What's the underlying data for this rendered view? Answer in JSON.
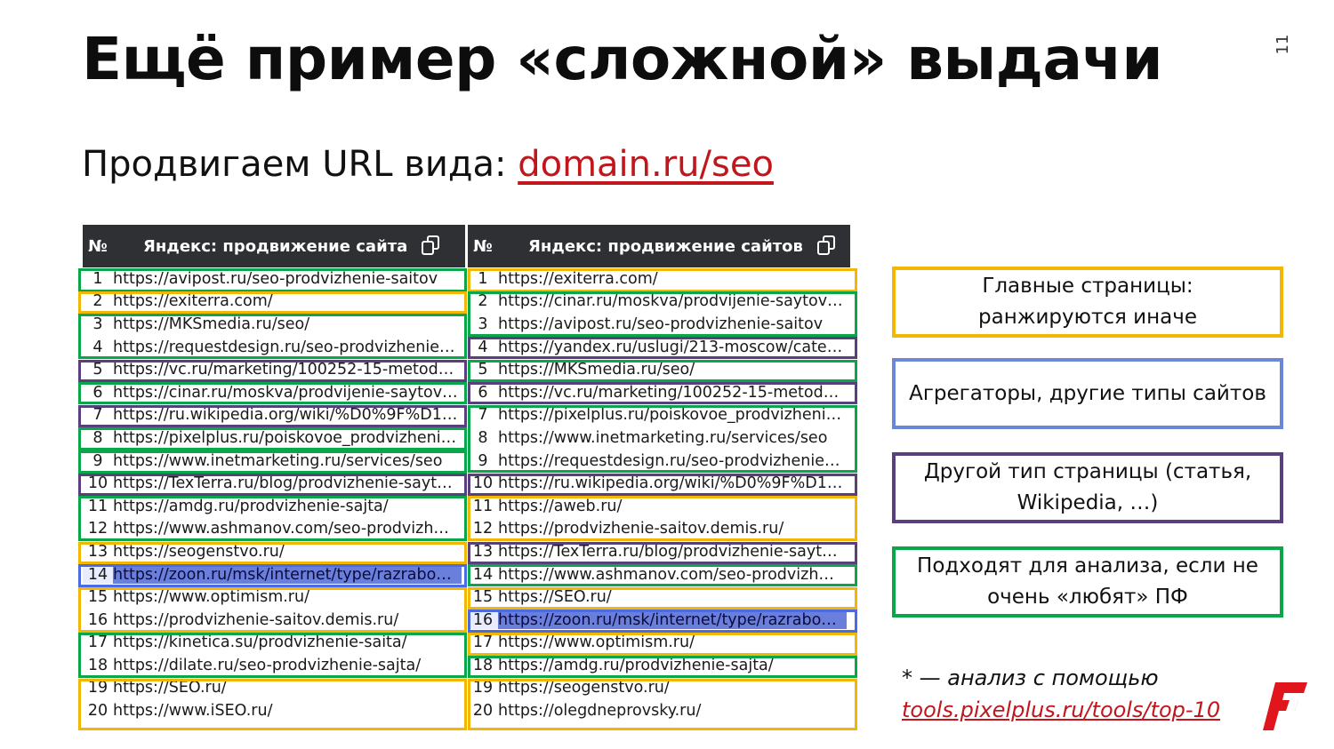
{
  "slide": {
    "title": "Ещё пример «сложной» выдачи",
    "number": "11",
    "subtitle_prefix": "Продвигаем URL вида: ",
    "subtitle_url": "domain.ru/seo"
  },
  "left_table": {
    "col_no": "№",
    "query": "Яндекс: продвижение сайта",
    "rows": [
      {
        "n": "1",
        "url": "https://avipost.ru/seo-prodvizhenie-saitov"
      },
      {
        "n": "2",
        "url": "https://exiterra.com/"
      },
      {
        "n": "3",
        "url": "https://MKSmedia.ru/seo/"
      },
      {
        "n": "4",
        "url": "https://requestdesign.ru/seo-prodvizhenie…"
      },
      {
        "n": "5",
        "url": "https://vc.ru/marketing/100252-15-metod…"
      },
      {
        "n": "6",
        "url": "https://cinar.ru/moskva/prodvijenie-saytov…"
      },
      {
        "n": "7",
        "url": "https://ru.wikipedia.org/wiki/%D0%9F%D1…"
      },
      {
        "n": "8",
        "url": "https://pixelplus.ru/poiskovoe_prodvizheni…"
      },
      {
        "n": "9",
        "url": "https://www.inetmarketing.ru/services/seo"
      },
      {
        "n": "10",
        "url": "https://TexTerra.ru/blog/prodvizhenie-sayt…"
      },
      {
        "n": "11",
        "url": "https://amdg.ru/prodvizhenie-sajta/"
      },
      {
        "n": "12",
        "url": "https://www.ashmanov.com/seo-prodvizh…"
      },
      {
        "n": "13",
        "url": "https://seogenstvo.ru/"
      },
      {
        "n": "14",
        "url": "https://zoon.ru/msk/internet/type/razrabo…"
      },
      {
        "n": "15",
        "url": "https://www.optimism.ru/"
      },
      {
        "n": "16",
        "url": "https://prodvizhenie-saitov.demis.ru/"
      },
      {
        "n": "17",
        "url": "https://kinetica.su/prodvizhenie-saita/"
      },
      {
        "n": "18",
        "url": "https://dilate.ru/seo-prodvizhenie-sajta/"
      },
      {
        "n": "19",
        "url": "https://SEO.ru/"
      },
      {
        "n": "20",
        "url": "https://www.iSEO.ru/"
      }
    ]
  },
  "right_table": {
    "col_no": "№",
    "query": "Яндекс: продвижение сайтов",
    "rows": [
      {
        "n": "1",
        "url": "https://exiterra.com/"
      },
      {
        "n": "2",
        "url": "https://cinar.ru/moskva/prodvijenie-saytov…"
      },
      {
        "n": "3",
        "url": "https://avipost.ru/seo-prodvizhenie-saitov"
      },
      {
        "n": "4",
        "url": "https://yandex.ru/uslugi/213-moscow/cate…"
      },
      {
        "n": "5",
        "url": "https://MKSmedia.ru/seo/"
      },
      {
        "n": "6",
        "url": "https://vc.ru/marketing/100252-15-metod…"
      },
      {
        "n": "7",
        "url": "https://pixelplus.ru/poiskovoe_prodvizheni…"
      },
      {
        "n": "8",
        "url": "https://www.inetmarketing.ru/services/seo"
      },
      {
        "n": "9",
        "url": "https://requestdesign.ru/seo-prodvizhenie…"
      },
      {
        "n": "10",
        "url": "https://ru.wikipedia.org/wiki/%D0%9F%D1…"
      },
      {
        "n": "11",
        "url": "https://aweb.ru/"
      },
      {
        "n": "12",
        "url": "https://prodvizhenie-saitov.demis.ru/"
      },
      {
        "n": "13",
        "url": "https://TexTerra.ru/blog/prodvizhenie-sayt…"
      },
      {
        "n": "14",
        "url": "https://www.ashmanov.com/seo-prodvizh…"
      },
      {
        "n": "15",
        "url": "https://SEO.ru/"
      },
      {
        "n": "16",
        "url": "https://zoon.ru/msk/internet/type/razrabo…"
      },
      {
        "n": "17",
        "url": "https://www.optimism.ru/"
      },
      {
        "n": "18",
        "url": "https://amdg.ru/prodvizhenie-sajta/"
      },
      {
        "n": "19",
        "url": "https://seogenstvo.ru/"
      },
      {
        "n": "20",
        "url": "https://olegdneprovsky.ru/"
      }
    ]
  },
  "legend": {
    "main_pages_1": "Главные страницы:",
    "main_pages_2": "ранжируются иначе",
    "aggregators": "Агрегаторы, другие типы сайтов",
    "other_type_1": "Другой тип страницы (статья,",
    "other_type_2": "Wikipedia, …)",
    "suitable_1": "Подходят для анализа, если не",
    "suitable_2": "очень «любят» ПФ"
  },
  "note": {
    "line1": "* — анализ с помощью",
    "link": "tools.pixelplus.ru/tools/top-10"
  },
  "colors": {
    "green": "#0aa64a",
    "yellow": "#f2b705",
    "purple": "#5a3f7e",
    "blue": "#4d6be0",
    "accent_red": "#c0161c",
    "header_dark": "#2e3033"
  }
}
